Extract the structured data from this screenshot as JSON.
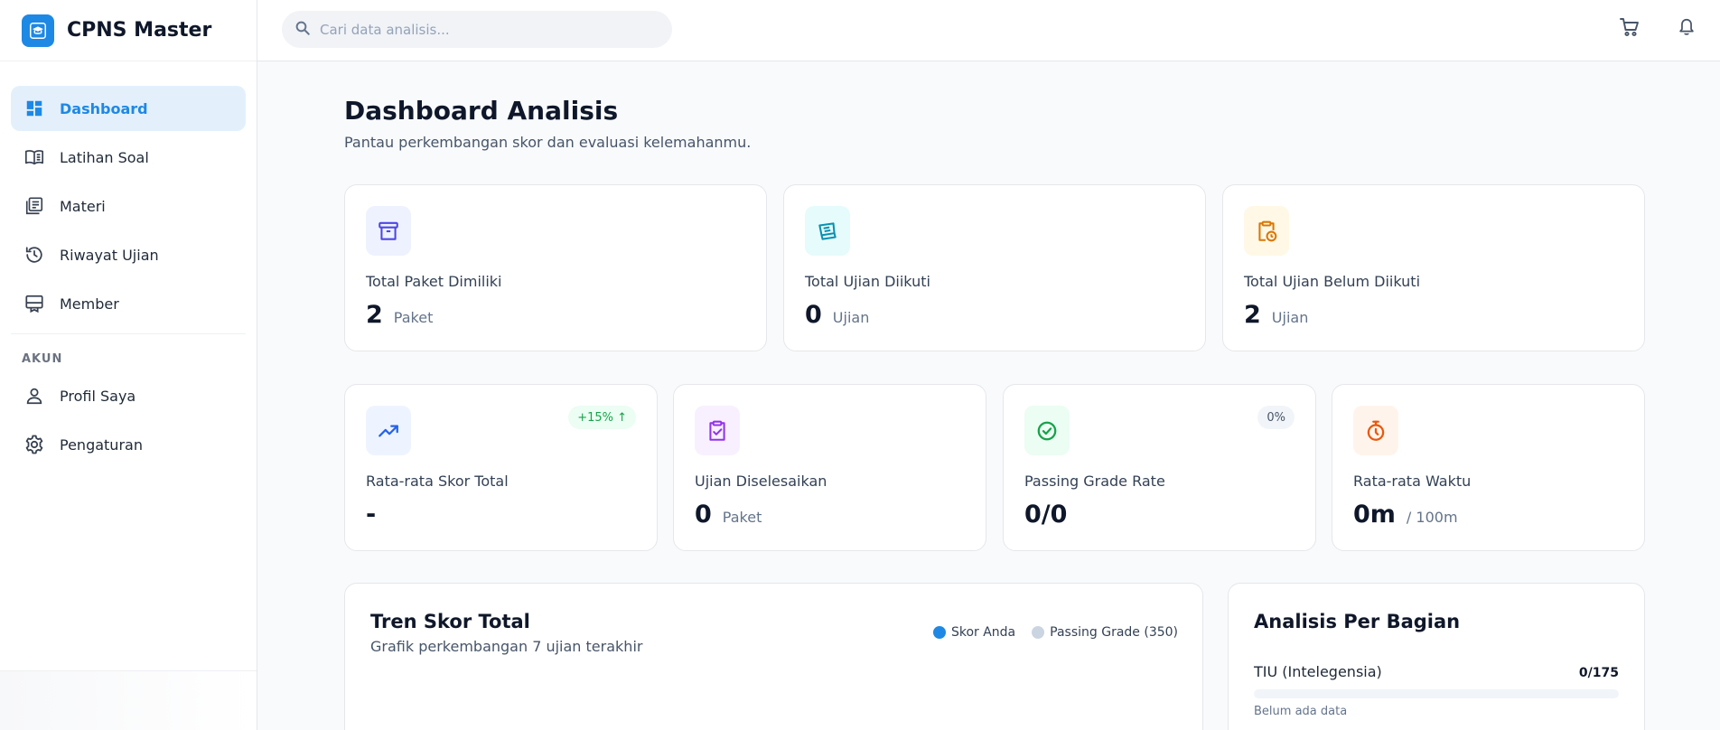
{
  "brand": {
    "name": "CPNS Master"
  },
  "search": {
    "placeholder": "Cari data analisis..."
  },
  "sidebar": {
    "items": [
      {
        "label": "Dashboard"
      },
      {
        "label": "Latihan Soal"
      },
      {
        "label": "Materi"
      },
      {
        "label": "Riwayat Ujian"
      },
      {
        "label": "Member"
      }
    ],
    "section_title": "AKUN",
    "account_items": [
      {
        "label": "Profil Saya"
      },
      {
        "label": "Pengaturan"
      }
    ]
  },
  "page": {
    "title": "Dashboard Analisis",
    "subtitle": "Pantau perkembangan skor dan evaluasi kelemahanmu."
  },
  "stats_top": [
    {
      "label": "Total Paket Dimiliki",
      "value": "2",
      "unit": "Paket"
    },
    {
      "label": "Total Ujian Diikuti",
      "value": "0",
      "unit": "Ujian"
    },
    {
      "label": "Total Ujian Belum Diikuti",
      "value": "2",
      "unit": "Ujian"
    }
  ],
  "stats_bottom": [
    {
      "label": "Rata-rata Skor Total",
      "value": "-",
      "badge": "+15% ↑"
    },
    {
      "label": "Ujian Diselesaikan",
      "value": "0",
      "unit": "Paket"
    },
    {
      "label": "Passing Grade Rate",
      "value": "0/0",
      "badge": "0%"
    },
    {
      "label": "Rata-rata Waktu",
      "value": "0m",
      "unit": "/ 100m"
    }
  ],
  "trend": {
    "title": "Tren Skor Total",
    "subtitle": "Grafik perkembangan 7 ujian terakhir",
    "legend": [
      {
        "label": "Skor Anda",
        "color": "#1e88e5"
      },
      {
        "label": "Passing Grade (350)",
        "color": "#cbd5e1"
      }
    ]
  },
  "analysis": {
    "title": "Analisis Per Bagian",
    "sections": [
      {
        "name": "TIU (Intelegensia)",
        "score": "0/175",
        "progress": 0,
        "note": "Belum ada data"
      }
    ]
  },
  "colors": {
    "accent": "#1e88e5",
    "active_bg": "#e3f0fc",
    "badge_green_bg": "#ecfdf3",
    "badge_green_text": "#16a34a"
  }
}
